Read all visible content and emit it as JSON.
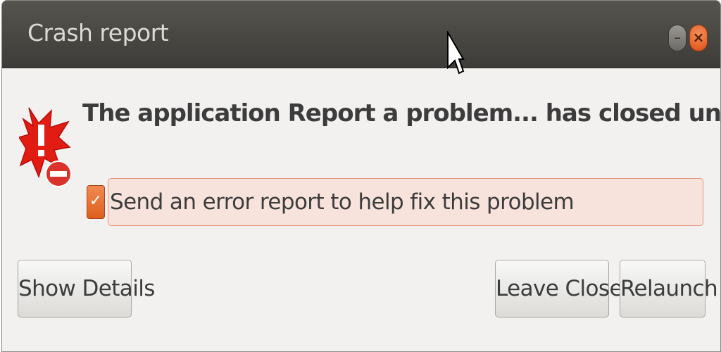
{
  "window": {
    "title": "Crash report",
    "minimize_glyph": "–",
    "close_glyph": "×"
  },
  "icon": "crash-error-icon",
  "message": {
    "headline": "The application Report a problem... has closed unexpectedly."
  },
  "report_option": {
    "checked": true,
    "check_glyph": "✓",
    "label": "Send an error report to help fix this problem"
  },
  "buttons": {
    "show_details": "Show Details",
    "leave_closed": "Leave Closed",
    "relaunch": "Relaunch"
  },
  "colors": {
    "titlebar": "#3e3c38",
    "accent": "#de5f1e",
    "close_button": "#dd4e14",
    "window_background": "#f2f1ef",
    "highlight_background": "#f7e3dc"
  }
}
